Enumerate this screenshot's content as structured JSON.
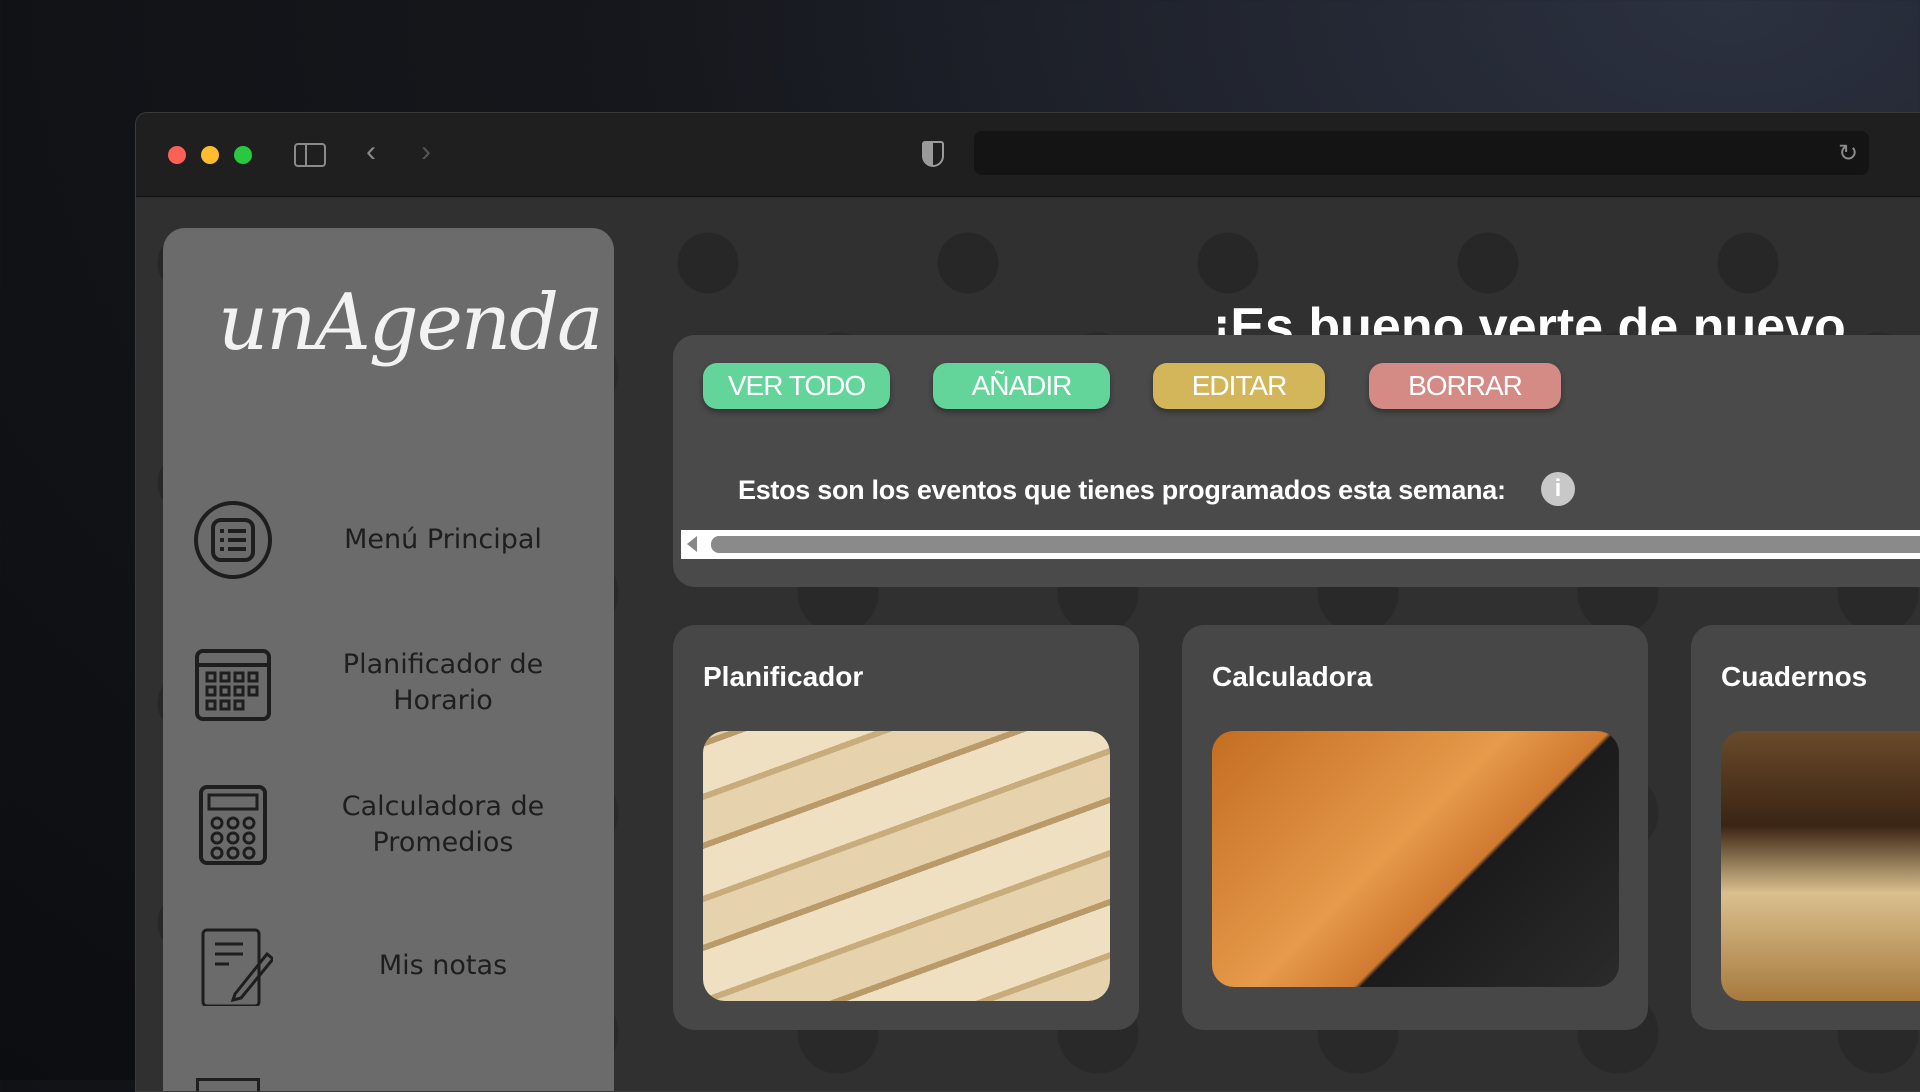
{
  "browser": {
    "traffic_lights": {
      "close": "#fe5f57",
      "minimize": "#febc2e",
      "maximize": "#28c840"
    },
    "url": ""
  },
  "sidebar": {
    "logo": "unAgenda",
    "items": [
      {
        "label": "Menú Principal",
        "icon": "list-icon"
      },
      {
        "label": "Planificador de Horario",
        "icon": "calendar-icon"
      },
      {
        "label": "Calculadora de Promedios",
        "icon": "calculator-icon"
      },
      {
        "label": "Mis notas",
        "icon": "notes-icon"
      }
    ]
  },
  "main": {
    "title": "¡Es bueno verte de nuevo,",
    "events": {
      "buttons": [
        {
          "label": "VER TODO",
          "color": "#63d49a"
        },
        {
          "label": "AÑADIR",
          "color": "#63d49a"
        },
        {
          "label": "EDITAR",
          "color": "#d4b65a"
        },
        {
          "label": "BORRAR",
          "color": "#d48a85"
        }
      ],
      "text": "Estos son los eventos que tienes programados esta semana:",
      "info": "i"
    },
    "cards": [
      {
        "title": "Planificador"
      },
      {
        "title": "Calculadora"
      },
      {
        "title": "Cuadernos"
      }
    ]
  }
}
